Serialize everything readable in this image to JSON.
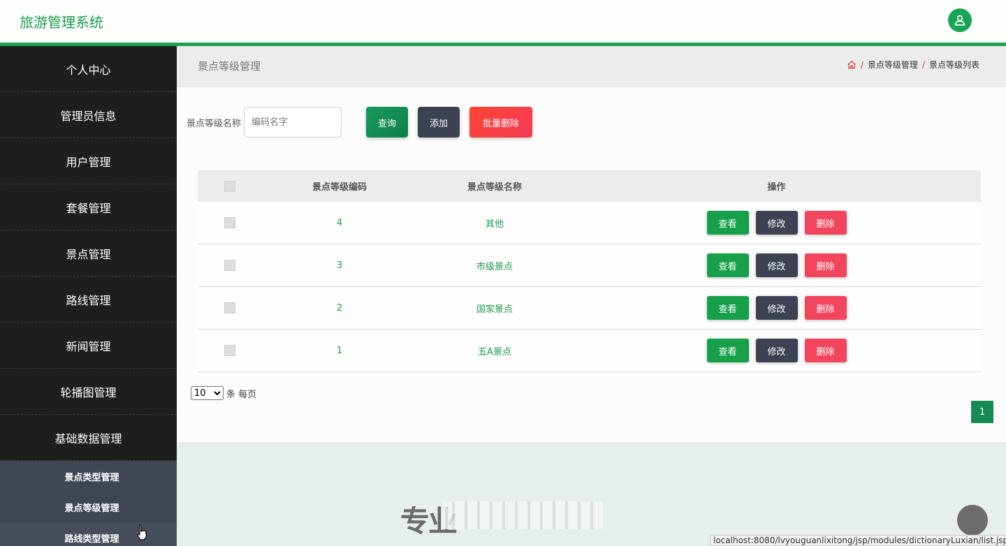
{
  "header": {
    "title": "旅游管理系统",
    "user_icon": "user-icon"
  },
  "sidebar": {
    "items": [
      {
        "label": "个人中心"
      },
      {
        "label": "管理员信息"
      },
      {
        "label": "用户管理"
      },
      {
        "label": "套餐管理"
      },
      {
        "label": "景点管理"
      },
      {
        "label": "路线管理"
      },
      {
        "label": "新闻管理"
      },
      {
        "label": "轮播图管理"
      },
      {
        "label": "基础数据管理"
      }
    ],
    "submenu": [
      {
        "label": "景点类型管理"
      },
      {
        "label": "景点等级管理"
      },
      {
        "label": "路线类型管理"
      }
    ]
  },
  "page": {
    "title": "景点等级管理",
    "breadcrumb": {
      "home_icon": "home-icon",
      "level1": "景点等级管理",
      "level2": "景点等级列表"
    }
  },
  "search": {
    "label": "景点等级名称",
    "placeholder": "编码名字",
    "query_label": "查询",
    "add_label": "添加",
    "batch_delete_label": "批量删除"
  },
  "table": {
    "headers": {
      "code": "景点等级编码",
      "name": "景点等级名称",
      "ops": "操作"
    },
    "rows": [
      {
        "code": "4",
        "name": "其他"
      },
      {
        "code": "3",
        "name": "市级景点"
      },
      {
        "code": "2",
        "name": "国家景点"
      },
      {
        "code": "1",
        "name": "五A景点"
      }
    ],
    "actions": {
      "view": "查看",
      "edit": "修改",
      "delete": "删除"
    }
  },
  "pagination": {
    "page_size": "10",
    "page_size_suffix": "条 每页",
    "current_page": "1"
  },
  "footer": {
    "watermark_text": "专业"
  },
  "status_bar": {
    "url": "localhost:8080/lvyouguanlixitong/jsp/modules/dictionaryLuxian/list.jsp"
  },
  "colors": {
    "accent": "#1fa24d",
    "sidebar_bg": "#1d1f1e",
    "danger": "#f2465e",
    "dark_button": "#3c4252"
  }
}
